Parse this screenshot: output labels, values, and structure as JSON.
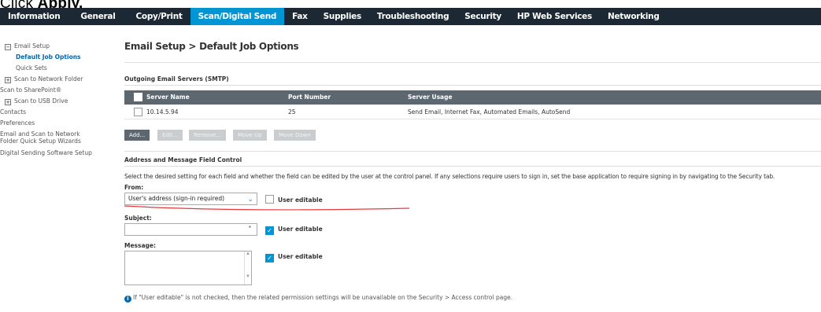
{
  "caption": {
    "prefix": "Click ",
    "bold": "Apply."
  },
  "nav": {
    "tabs": [
      "Information",
      "General",
      "Copy/Print",
      "Scan/Digital Send",
      "Fax",
      "Supplies",
      "Troubleshooting",
      "Security",
      "HP Web Services",
      "Networking"
    ],
    "active_index": 3
  },
  "sidebar": {
    "email_setup": "Email Setup",
    "default_job_options": "Default Job Options",
    "quick_sets": "Quick Sets",
    "scan_to_network_folder": "Scan to Network Folder",
    "scan_to_sharepoint": "Scan to SharePoint®",
    "scan_to_usb_drive": "Scan to USB Drive",
    "contacts": "Contacts",
    "preferences": "Preferences",
    "email_wizard_line1": "Email and Scan to Network",
    "email_wizard_line2": "Folder Quick Setup Wizards",
    "digital_sending_setup": "Digital Sending Software Setup",
    "toggle_collapse": "−",
    "toggle_expand": "+"
  },
  "page": {
    "title": "Email Setup > Default Job Options"
  },
  "smtp": {
    "section_title": "Outgoing Email Servers (SMTP)",
    "columns": [
      "Server Name",
      "Port Number",
      "Server Usage"
    ],
    "rows": [
      {
        "server_name": "10.14.5.94",
        "port": "25",
        "usage": "Send Email, Internet Fax, Automated Emails, AutoSend"
      }
    ],
    "buttons": {
      "add": "Add...",
      "edit": "Edit...",
      "remove": "Remove...",
      "move_up": "Move Up",
      "move_down": "Move Down"
    }
  },
  "address": {
    "section_title": "Address and Message Field Control",
    "description": "Select the desired setting for each field and whether the field can be edited by the user at the control panel. If any selections require users to sign in, set the base application to require signing in by navigating to the Security tab.",
    "from_label": "From:",
    "from_value": "User's address (sign-in required)",
    "from_user_editable": false,
    "subject_label": "Subject:",
    "subject_value": "",
    "subject_user_editable": true,
    "message_label": "Message:",
    "message_value": "",
    "message_user_editable": true,
    "user_editable_label": "User editable",
    "required_marker": "*",
    "note": "If \"User editable\" is not checked, then the related permission settings will be unavailable on the Security > Access control page."
  },
  "icons": {
    "dropdown": "chevron-down-icon",
    "info": "info-icon",
    "check": "checkmark-icon"
  },
  "colors": {
    "nav_bg": "#1c2833",
    "active_tab": "#0096d6",
    "table_header": "#5c6770",
    "link_blue": "#0067b1",
    "annotation_red": "#e8383d"
  }
}
